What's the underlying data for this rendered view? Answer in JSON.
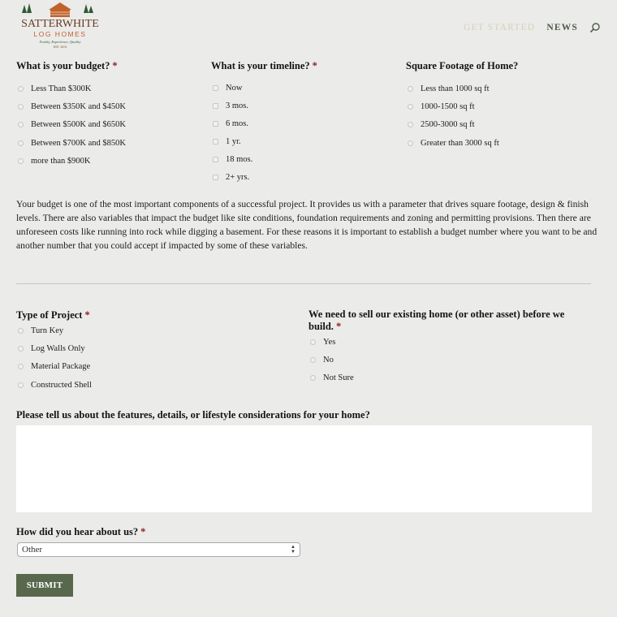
{
  "header": {
    "logo": {
      "name": "SATTERWHITE",
      "sub": "LOG HOMES",
      "tagline": "Family, Experience, Quality",
      "est": "EST. 1974"
    },
    "nav": [
      {
        "label": "GET STARTED"
      },
      {
        "label": "NEWS"
      }
    ],
    "search_icon": "search-icon"
  },
  "colors": {
    "accent_green": "#58684c",
    "nav_active": "#d6d0b4",
    "required": "#8b1a1a",
    "logo_orange": "#c0622a",
    "logo_brown": "#6b3a22",
    "logo_green": "#2f5a34"
  },
  "budget": {
    "title": "What is your budget?",
    "required": "*",
    "options": [
      "Less Than $300K",
      "Between $350K and $450K",
      "Between $500K and $650K",
      "Between $700K and $850K",
      "more than $900K"
    ]
  },
  "timeline": {
    "title": "What is your timeline?",
    "required": "*",
    "options": [
      "Now",
      "3 mos.",
      "6 mos.",
      "1 yr.",
      "18 mos.",
      "2+ yrs."
    ]
  },
  "footage": {
    "title": "Square Footage of Home?",
    "options": [
      "Less than 1000 sq ft",
      "1000-1500 sq ft",
      "2500-3000 sq ft",
      "Greater than 3000 sq ft"
    ]
  },
  "budget_note": "Your budget is one of the most important components of a successful project. It provides us with a parameter that drives square footage, design & finish levels. There are also variables that impact the budget like site conditions, foundation requirements and zoning and permitting provisions. Then there are unforeseen costs like running into rock while digging a basement. For these reasons it is important to establish a budget number where you want to be and another number that you could accept if impacted by some of these variables.",
  "project_type": {
    "title": "Type of Project",
    "required": "*",
    "options": [
      "Turn Key",
      "Log Walls Only",
      "Material Package",
      "Constructed Shell"
    ]
  },
  "sell_home": {
    "title": "We need to sell our existing home (or other asset) before we build.",
    "required": "*",
    "options": [
      "Yes",
      "No",
      "Not Sure"
    ]
  },
  "features": {
    "title": "Please tell us about the features, details, or lifestyle considerations for your home?",
    "value": ""
  },
  "referral": {
    "title": "How did you hear about us?",
    "required": "*",
    "selected": "Other"
  },
  "submit_label": "SUBMIT"
}
